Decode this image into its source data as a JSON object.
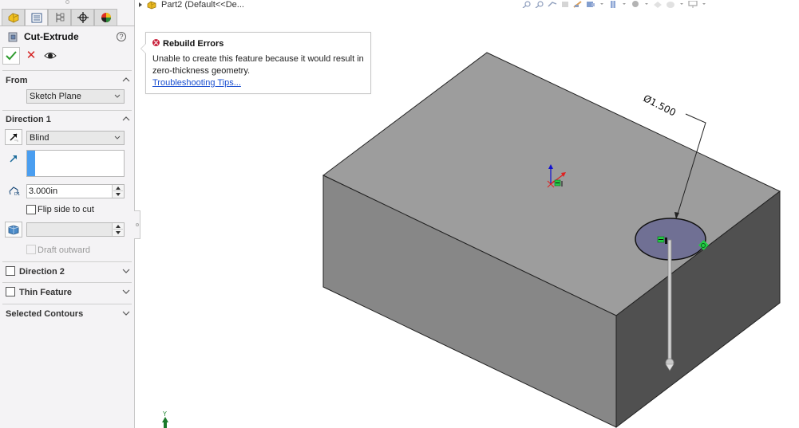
{
  "property_manager": {
    "tabs": [
      {
        "id": "feature-manager",
        "icon": "feature-manager-icon",
        "active": false
      },
      {
        "id": "property-manager",
        "icon": "property-manager-icon",
        "active": true
      },
      {
        "id": "configuration-manager",
        "icon": "configuration-manager-icon",
        "active": false
      },
      {
        "id": "dimxpert-manager",
        "icon": "dimxpert-icon",
        "active": false
      },
      {
        "id": "display-manager",
        "icon": "display-manager-icon",
        "active": false
      }
    ],
    "title": "Cut-Extrude",
    "help_label": "?",
    "ok_label": "OK",
    "cancel_label": "✕",
    "from": {
      "heading": "From",
      "value": "Sketch Plane"
    },
    "direction1": {
      "heading": "Direction 1",
      "end_condition": "Blind",
      "depth": "3.000in",
      "flip_side_label": "Flip side to cut",
      "flip_side_checked": false,
      "draft_value": "",
      "draft_outward_label": "Draft outward",
      "draft_outward_enabled": false
    },
    "direction2": {
      "heading": "Direction 2",
      "checked": false
    },
    "thin_feature": {
      "heading": "Thin Feature",
      "checked": false
    },
    "selected_contours": {
      "heading": "Selected Contours"
    }
  },
  "viewport": {
    "tree_item": "Part2  (Default<<De...",
    "tooltip": {
      "title": "Rebuild Errors",
      "message": "Unable to create this feature because it would result in zero-thickness geometry.",
      "link": "Troubleshooting Tips..."
    },
    "dimension": "Ø1.500",
    "triad_label": "Y",
    "toolbar_icons": [
      "zoom-to-fit-icon",
      "zoom-to-area-icon",
      "previous-view-icon",
      "section-view-icon",
      "dynamic-annotation-icon",
      "view-orientation-icon",
      "display-style-icon",
      "hide-show-items-icon",
      "edit-appearance-icon",
      "apply-scene-icon",
      "view-settings-icon"
    ]
  },
  "colors": {
    "accent_blue": "#4a9ef0",
    "ok_green": "#2e9b2e",
    "cancel_red": "#d42020",
    "error_red": "#c8203a",
    "link_blue": "#1a4fd0",
    "face_top": "#9d9d9d",
    "face_front": "#868686",
    "face_right": "#4f4f4f",
    "sketch_fill": "#707094"
  }
}
